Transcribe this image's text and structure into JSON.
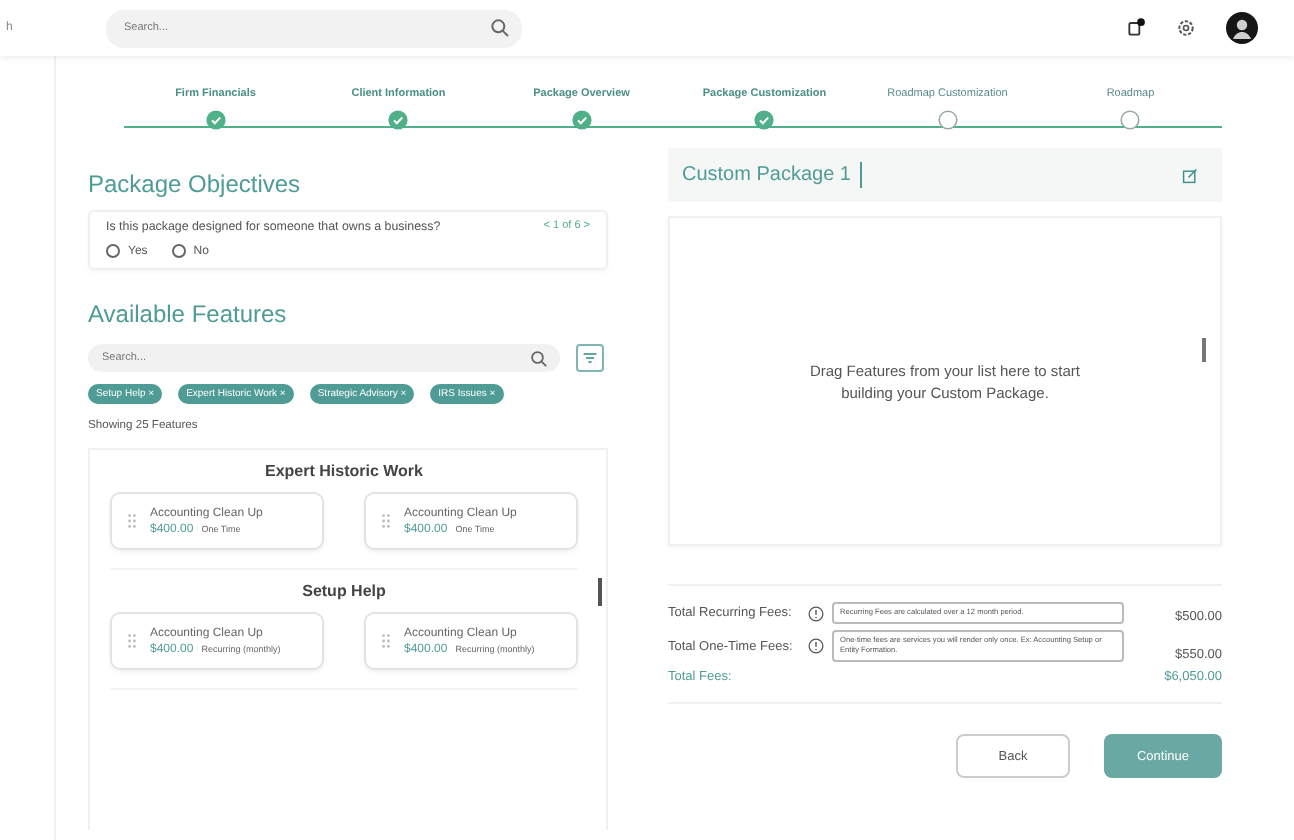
{
  "sidebar": {
    "text": "h"
  },
  "topbar": {
    "search": {
      "placeholder": "Search..."
    },
    "notification_badge": true
  },
  "steps": [
    {
      "label": "Firm Financials",
      "completed": true
    },
    {
      "label": "Client Information",
      "completed": true
    },
    {
      "label": "Package Overview",
      "completed": true
    },
    {
      "label": "Package Customization",
      "completed": true
    },
    {
      "label": "Roadmap Customization",
      "completed": false
    },
    {
      "label": "Roadmap",
      "completed": false
    }
  ],
  "objectives": {
    "title": "Package Objectives",
    "question": "Is this package designed for someone that owns a business?",
    "pager": "< 1 of 6 >",
    "options": [
      {
        "label": "Yes",
        "selected": false
      },
      {
        "label": "No",
        "selected": false
      }
    ]
  },
  "features": {
    "title": "Available Features",
    "search": {
      "placeholder": "Search..."
    },
    "tags": [
      "Setup Help ×",
      "Expert Historic Work ×",
      "Strategic Advisory ×",
      "IRS Issues ×"
    ],
    "count": "Showing 25 Features",
    "groups": [
      {
        "title": "Expert Historic Work",
        "items": [
          {
            "name": "Accounting Clean Up",
            "price": "$400.00",
            "billing": "One Time"
          },
          {
            "name": "Accounting Clean Up",
            "price": "$400.00",
            "billing": "One Time"
          }
        ]
      },
      {
        "title": "Setup Help",
        "items": [
          {
            "name": "Accounting Clean Up",
            "price": "$400.00",
            "billing": "Recurring (monthly)"
          },
          {
            "name": "Accounting Clean Up",
            "price": "$400.00",
            "billing": "Recurring (monthly)"
          }
        ]
      }
    ]
  },
  "custom_package": {
    "title": "Custom Package 1",
    "empty_message": "Drag Features from your list here to start building your Custom Package."
  },
  "fees": {
    "rows": [
      {
        "label": "Total Recurring Fees:",
        "tooltip": "Recurring Fees are calculated over a 12 month period.",
        "amount": "$500.00"
      },
      {
        "label": "Total One-Time Fees:",
        "tooltip": "One-time fees are services you will render only once. Ex: Accounting Setup or Entity Formation.",
        "amount": "$550.00"
      }
    ],
    "total": {
      "label": "Total Fees:",
      "amount": "$6,050.00"
    }
  },
  "buttons": {
    "back": "Back",
    "continue": "Continue"
  }
}
